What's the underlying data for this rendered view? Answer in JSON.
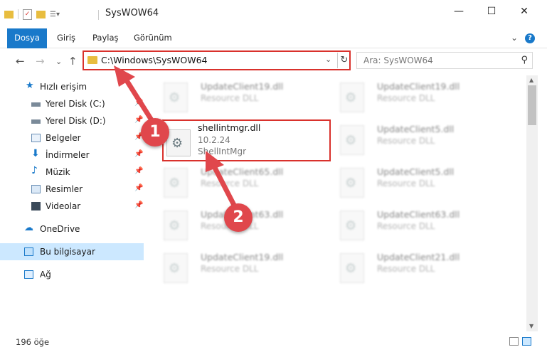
{
  "window": {
    "title": "SysWOW64",
    "minimize": "—",
    "maximize": "☐",
    "close": "✕"
  },
  "ribbon": {
    "tabs": [
      "Dosya",
      "Giriş",
      "Paylaş",
      "Görünüm"
    ],
    "collapse": "⌄",
    "help": "?"
  },
  "navigation": {
    "back": "←",
    "forward": "→",
    "recent": "⌄",
    "up": "↑",
    "address": "C:\\Windows\\SysWOW64",
    "address_dropdown": "⌄",
    "refresh": "↻",
    "search_placeholder": "Ara: SysWOW64",
    "search_icon": "⚲"
  },
  "sidebar": {
    "items": [
      {
        "label": "Hızlı erişim",
        "icon": "star-icon",
        "pinned": false,
        "selected": false
      },
      {
        "label": "Yerel Disk (C:)",
        "icon": "drive-icon",
        "pinned": true,
        "selected": false
      },
      {
        "label": "Yerel Disk (D:)",
        "icon": "drive-icon",
        "pinned": true,
        "selected": false
      },
      {
        "label": "Belgeler",
        "icon": "documents-icon",
        "pinned": true,
        "selected": false
      },
      {
        "label": "İndirmeler",
        "icon": "downloads-icon",
        "pinned": true,
        "selected": false
      },
      {
        "label": "Müzik",
        "icon": "music-icon",
        "pinned": true,
        "selected": false
      },
      {
        "label": "Resimler",
        "icon": "pictures-icon",
        "pinned": true,
        "selected": false
      },
      {
        "label": "Videolar",
        "icon": "videos-icon",
        "pinned": true,
        "selected": false
      },
      {
        "label": "OneDrive",
        "icon": "cloud-icon",
        "pinned": false,
        "selected": false
      },
      {
        "label": "Bu bilgisayar",
        "icon": "computer-icon",
        "pinned": false,
        "selected": true
      },
      {
        "label": "Ağ",
        "icon": "network-icon",
        "pinned": false,
        "selected": false
      }
    ],
    "pin_glyph": "📌"
  },
  "files": {
    "left": [
      {
        "name": "UpdateClient19.dll",
        "type": "Resource DLL"
      },
      {
        "name": "UpdateClient65.dll",
        "type": "Resource DLL"
      },
      {
        "name": "UpdateClient63.dll",
        "type": "Resource DLL"
      },
      {
        "name": "UpdateClient19.dll",
        "type": "Resource DLL"
      }
    ],
    "right": [
      {
        "name": "UpdateClient19.dll",
        "type": "Resource DLL"
      },
      {
        "name": "UpdateClient5.dll",
        "type": "Resource DLL"
      },
      {
        "name": "UpdateClient5.dll",
        "type": "Resource DLL"
      },
      {
        "name": "UpdateClient63.dll",
        "type": "Resource DLL"
      },
      {
        "name": "UpdateClient21.dll",
        "type": "Resource DLL"
      }
    ],
    "highlighted": {
      "name": "shellintmgr.dll",
      "version": "10.2.24",
      "description": "ShellIntMgr"
    }
  },
  "status": {
    "count": "196 öğe"
  },
  "annotations": {
    "step1": "1",
    "step2": "2",
    "color": "#e0474c"
  }
}
